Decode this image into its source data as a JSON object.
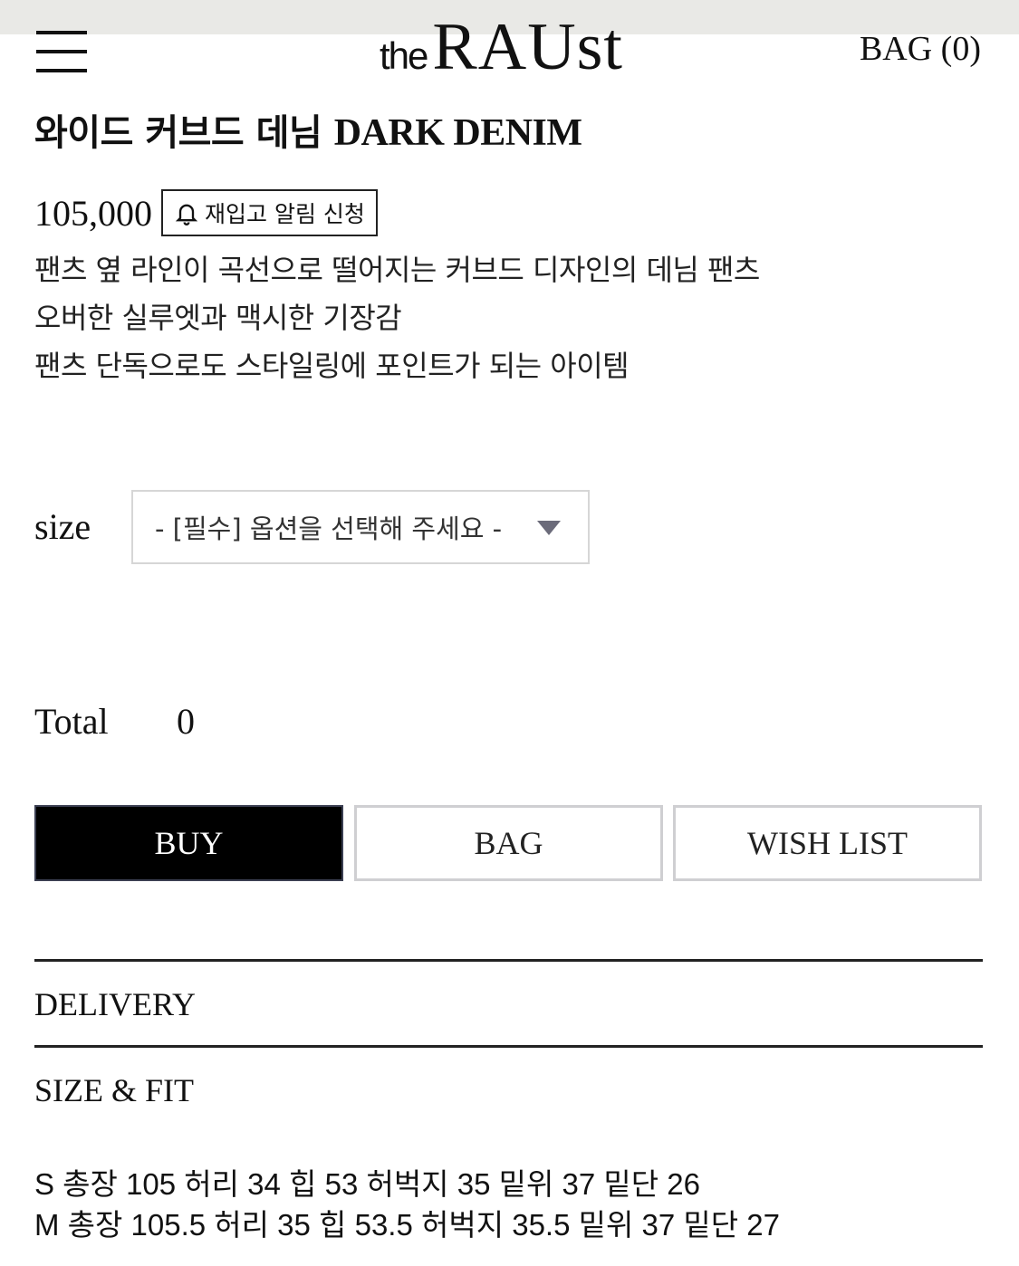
{
  "header": {
    "logo_the": "the",
    "logo_main": "RAUst",
    "bag_label": "BAG (0)"
  },
  "product": {
    "title_ko": "와이드 커브드 데님",
    "title_en": "DARK DENIM",
    "price": "105,000",
    "restock_label": "재입고 알림 신청",
    "description": [
      "팬츠 옆 라인이 곡선으로 떨어지는 커브드 디자인의 데님 팬츠",
      "오버한 실루엣과 맥시한 기장감",
      "팬츠 단독으로도 스타일링에 포인트가 되는 아이템"
    ]
  },
  "options": {
    "size_label": "size",
    "size_selected": "- [필수] 옵션을 선택해 주세요 -"
  },
  "total": {
    "label": "Total",
    "value": "0"
  },
  "actions": {
    "buy": "BUY",
    "bag": "BAG",
    "wish": "WISH LIST"
  },
  "sections": {
    "delivery": "DELIVERY",
    "size_fit": "SIZE & FIT"
  },
  "size_specs": [
    "S 총장 105 허리 34 힙 53 허벅지 35 밑위 37 밑단 26",
    "M 총장 105.5 허리 35 힙 53.5 허벅지 35.5 밑위 37 밑단 27"
  ],
  "icons": {
    "menu": "hamburger-icon",
    "bell": "bell-icon",
    "dropdown": "triangle-down-icon"
  }
}
